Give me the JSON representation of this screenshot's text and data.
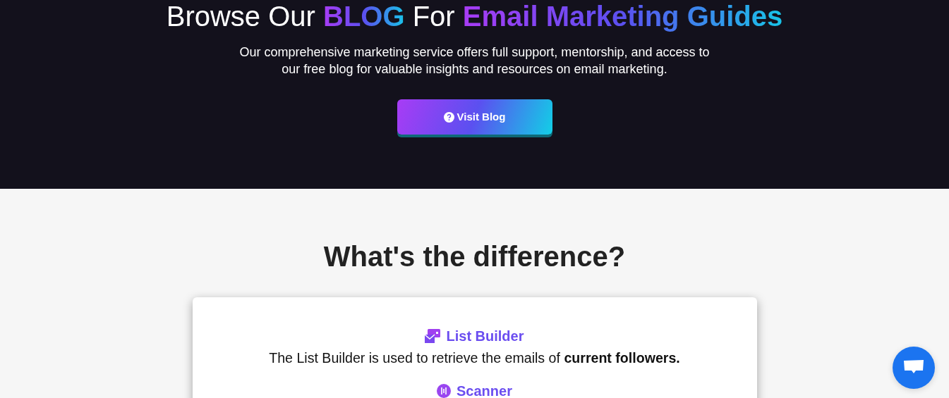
{
  "hero": {
    "heading": [
      {
        "text": "Browse Our ",
        "kind": "plain"
      },
      {
        "text": "BLOG",
        "kind": "gradient"
      },
      {
        "text": " For ",
        "kind": "plain"
      },
      {
        "text": "Email Marketing Guides",
        "kind": "gradient"
      }
    ],
    "subtitle": "Our comprehensive marketing service offers full support, mentorship, and access to our free blog for valuable insights and resources on email marketing.",
    "button": "Visit Blog"
  },
  "comparison": {
    "heading": "What's the difference?",
    "items": [
      {
        "kind": "list",
        "title": "List Builder",
        "description": "The List Builder is used to retrieve the emails of **current followers.**"
      },
      {
        "kind": "scanner",
        "title": "Scanner"
      }
    ]
  },
  "chat_button": {
    "kind": "chat"
  }
}
